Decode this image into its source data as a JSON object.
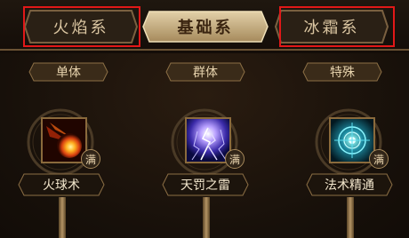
{
  "tabs": [
    {
      "label": "火焰系",
      "active": false,
      "highlighted": true
    },
    {
      "label": "基础系",
      "active": true,
      "highlighted": false
    },
    {
      "label": "冰霜系",
      "active": false,
      "highlighted": true
    }
  ],
  "categories": [
    "单体",
    "群体",
    "特殊"
  ],
  "skills": [
    {
      "name": "火球术",
      "badge": "满",
      "icon": "fireball-icon"
    },
    {
      "name": "天罚之雷",
      "badge": "满",
      "icon": "lightning-icon"
    },
    {
      "name": "法术精通",
      "badge": "满",
      "icon": "arcane-mastery-icon"
    }
  ],
  "colors": {
    "highlight_box": "#e11818",
    "text_gold": "#e7d3ad",
    "active_tab_fill": "#cbb58c"
  }
}
